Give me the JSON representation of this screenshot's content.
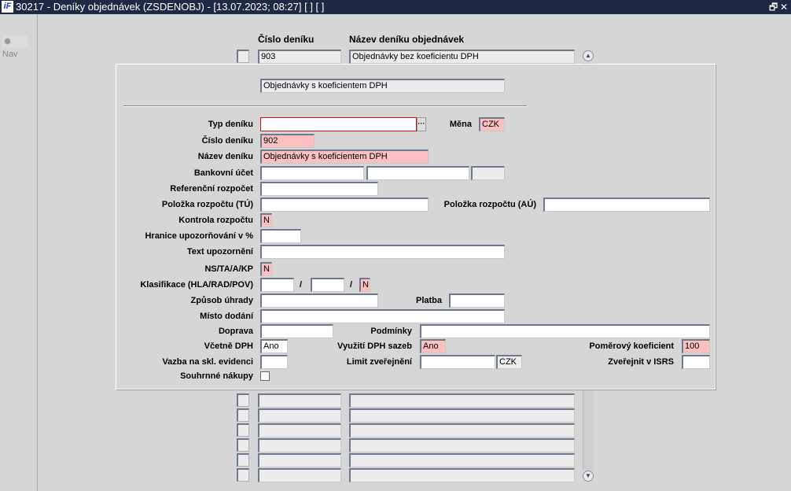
{
  "window": {
    "title": "30217 - Deníky objednávek (ZSDENOBJ) - [13.07.2023; 08:27]  [ ]  [ ]",
    "logo": "iF",
    "restore": "🗗",
    "close": "✕"
  },
  "nav": {
    "label": "Nav"
  },
  "list": {
    "col_number": "Číslo deníku",
    "col_name": "Název deníku objednávek",
    "first_row": {
      "number": "903",
      "name": "Objednávky bez koeficientu DPH"
    }
  },
  "dialog": {
    "heading_value": "Objednávky s koeficientem DPH",
    "labels": {
      "typ": "Typ deníku",
      "mena": "Měna",
      "cislo": "Číslo deníku",
      "nazev": "Název deníku",
      "bank": "Bankovní účet",
      "ref": "Referenční rozpočet",
      "pol_tu": "Položka rozpočtu (TÚ)",
      "pol_au": "Položka rozpočtu (AÚ)",
      "kontrola": "Kontrola rozpočtu",
      "hranice": "Hranice upozorňování v %",
      "text": "Text upozornění",
      "ns": "NS/TA/A/KP",
      "klas": "Klasifikace (HLA/RAD/POV)",
      "zpusob": "Způsob úhrady",
      "platba": "Platba",
      "misto": "Místo dodání",
      "doprava": "Doprava",
      "podminky": "Podmínky",
      "vcetne": "Včetně DPH",
      "vyuziti": "Využití DPH sazeb",
      "pomer": "Poměrový koeficient",
      "vazba": "Vazba na skl. evidenci",
      "limit": "Limit zveřejnění",
      "zverejnit": "Zveřejnit v ISRS",
      "souhrnne": "Souhrnné nákupy"
    },
    "values": {
      "typ": "",
      "lov_button": "···",
      "mena": "CZK",
      "cislo": "902",
      "nazev": "Objednávky s koeficientem DPH",
      "kontrola": "N",
      "ns": "N",
      "klas_pov": "N",
      "klas_sep": "/",
      "vcetne": "Ano",
      "vyuziti": "Ano",
      "pomer": "100",
      "limit_currency": "CZK"
    }
  },
  "scroll": {
    "up": "▲",
    "down": "▼"
  }
}
